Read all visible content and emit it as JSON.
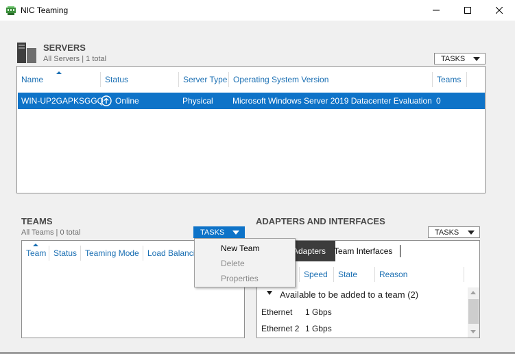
{
  "window": {
    "title": "NIC Teaming"
  },
  "servers": {
    "title": "SERVERS",
    "subtitle": "All Servers | 1 total",
    "tasks_label": "TASKS",
    "columns": [
      "Name",
      "Status",
      "Server Type",
      "Operating System Version",
      "Teams"
    ],
    "rows": [
      {
        "name": "WIN-UP2GAPKSGGQ",
        "status": "Online",
        "server_type": "Physical",
        "os_version": "Microsoft Windows Server 2019 Datacenter Evaluation",
        "teams": "0"
      }
    ]
  },
  "teams": {
    "title": "TEAMS",
    "subtitle": "All Teams | 0 total",
    "tasks_label": "TASKS",
    "columns": [
      "Team",
      "Status",
      "Teaming Mode",
      "Load Balanci"
    ],
    "menu": [
      {
        "label": "New Team",
        "enabled": true
      },
      {
        "label": "Delete",
        "enabled": false
      },
      {
        "label": "Properties",
        "enabled": false
      }
    ]
  },
  "adapters": {
    "title": "ADAPTERS AND INTERFACES",
    "tasks_label": "TASKS",
    "tabs": [
      "Adapters",
      "Team Interfaces"
    ],
    "columns": [
      "Speed",
      "State",
      "Reason"
    ],
    "group_label": "Available to be added to a team (2)",
    "rows": [
      {
        "name": "Ethernet",
        "speed": "1 Gbps"
      },
      {
        "name": "Ethernet 2",
        "speed": "1 Gbps"
      }
    ]
  },
  "colors": {
    "accent": "#0e73c8",
    "header_text": "#1a6fb3"
  }
}
